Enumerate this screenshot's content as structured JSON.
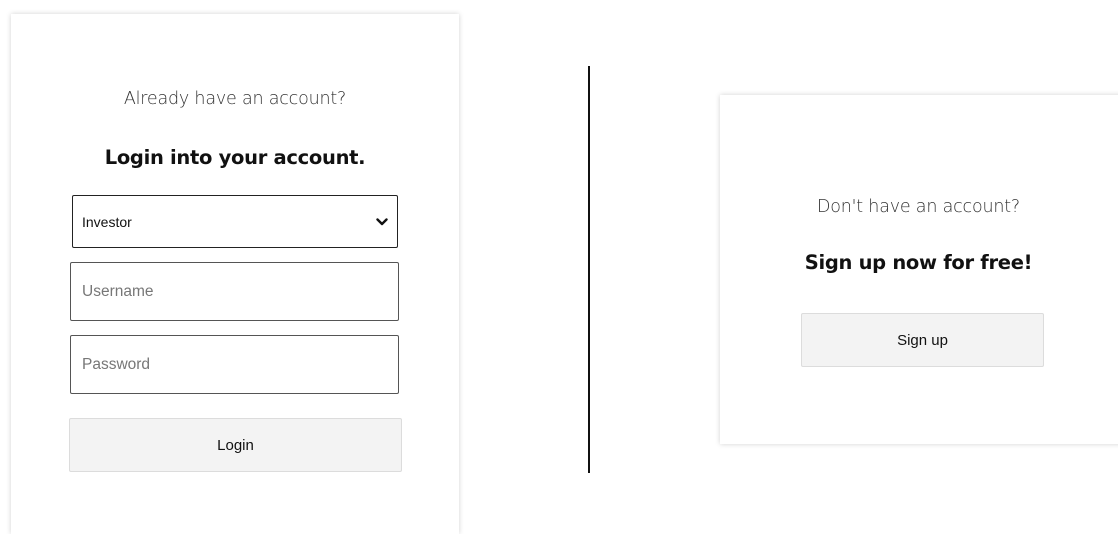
{
  "login": {
    "subtitle": "Already have an account?",
    "heading": "Login into your account.",
    "account_type": {
      "selected": "Investor"
    },
    "username": {
      "placeholder": "Username"
    },
    "password": {
      "placeholder": "Password"
    },
    "login_label": "Login"
  },
  "signup": {
    "subtitle": "Don't have an account?",
    "heading": "Sign up now for free!",
    "signup_label": "Sign up"
  }
}
